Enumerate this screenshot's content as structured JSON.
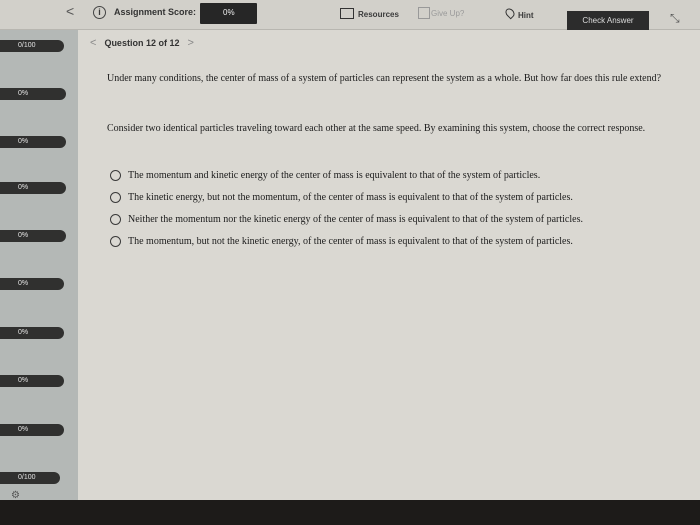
{
  "toolbar": {
    "back": "<",
    "info_icon": "i",
    "score_label": "Assignment Score:",
    "score_value": "0%",
    "resources": "Resources",
    "give_up": "Give Up?",
    "hint": "Hint",
    "check_answer": "Check Answer",
    "expand_icon": "⤡"
  },
  "sidebar": {
    "items": [
      "0/100",
      "0%",
      "0%",
      "0%",
      "0%",
      "0%",
      "0%",
      "0%",
      "0%",
      "0/100"
    ]
  },
  "question": {
    "prev": "<",
    "title": "Question 12 of 12",
    "next": ">",
    "intro": "Under many conditions, the center of mass of a system of particles can represent the system as a whole. But how far does this rule extend?",
    "prompt": "Consider two identical particles traveling toward each other at the same speed. By examining this system, choose the correct response.",
    "options": [
      "The momentum and kinetic energy of the center of mass is equivalent to that of the system of particles.",
      "The kinetic energy, but not the momentum, of the center of mass is equivalent to that of the system of particles.",
      "Neither the momentum nor the kinetic energy of the center of mass is equivalent to that of the system of particles.",
      "The momentum, but not the kinetic energy, of the center of mass is equivalent to that of the system of particles."
    ]
  }
}
